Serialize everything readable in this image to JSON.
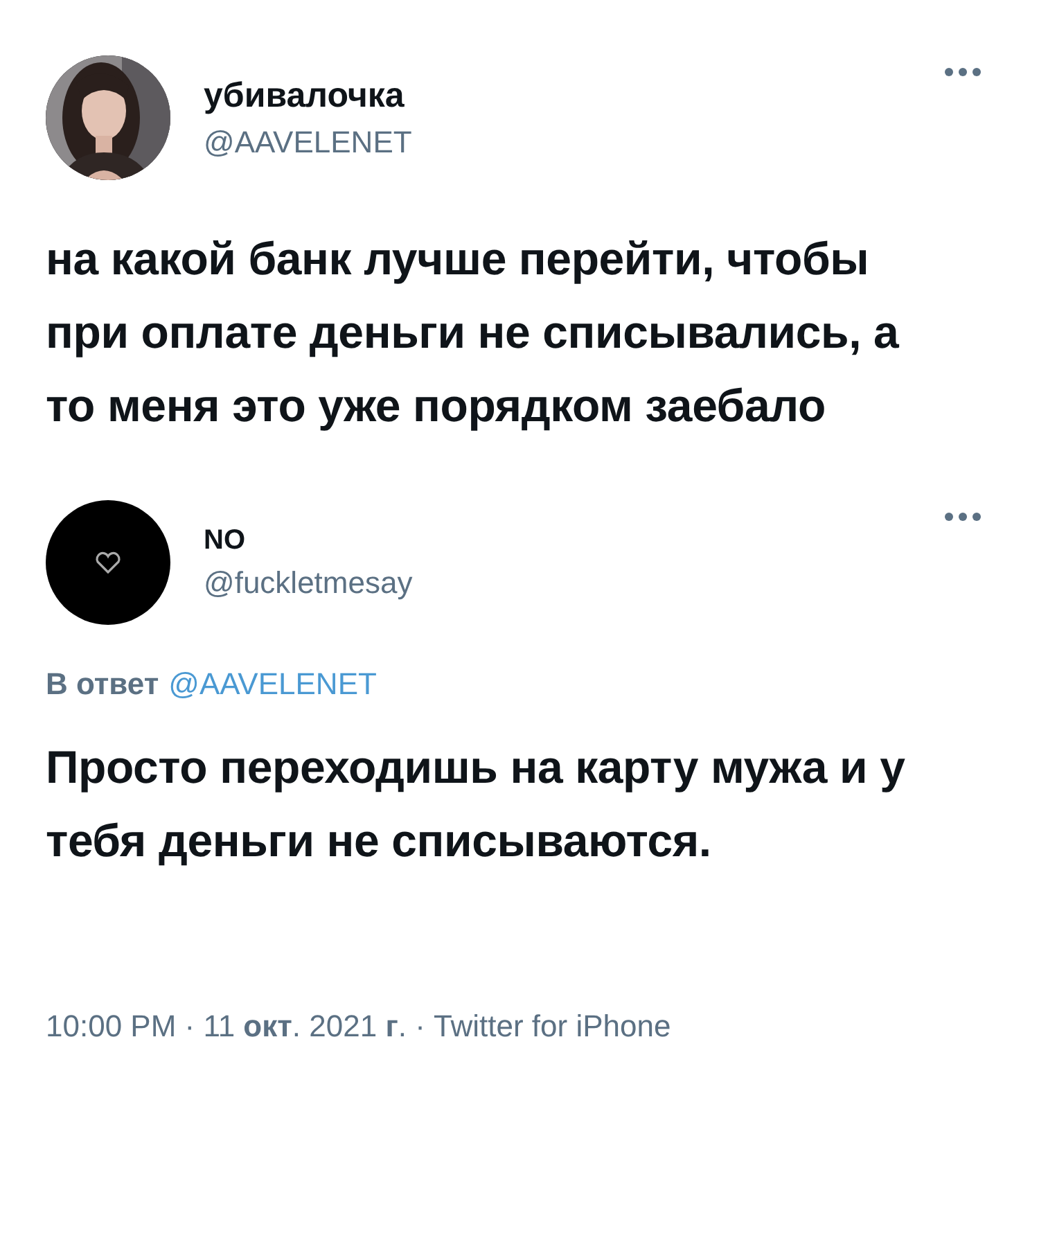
{
  "tweet": {
    "author": {
      "name": "убивалочка",
      "handle": "@AAVELENET"
    },
    "text": "на какой банк лучше перейти, чтобы при оплате деньги не списывались, а то меня это уже порядком заебало"
  },
  "reply": {
    "author": {
      "name": "NO",
      "handle": "@fuckletmesay",
      "avatar": {
        "kind": "heart"
      }
    },
    "reply_to_label": "В ответ",
    "reply_to_handle": "@AAVELENET",
    "text": "Просто переходишь на карту мужа и у тебя деньги не списываются.",
    "footer": "10:00 PM · 11 **окт**. 2021 **г**. · Twitter for iPhone"
  }
}
